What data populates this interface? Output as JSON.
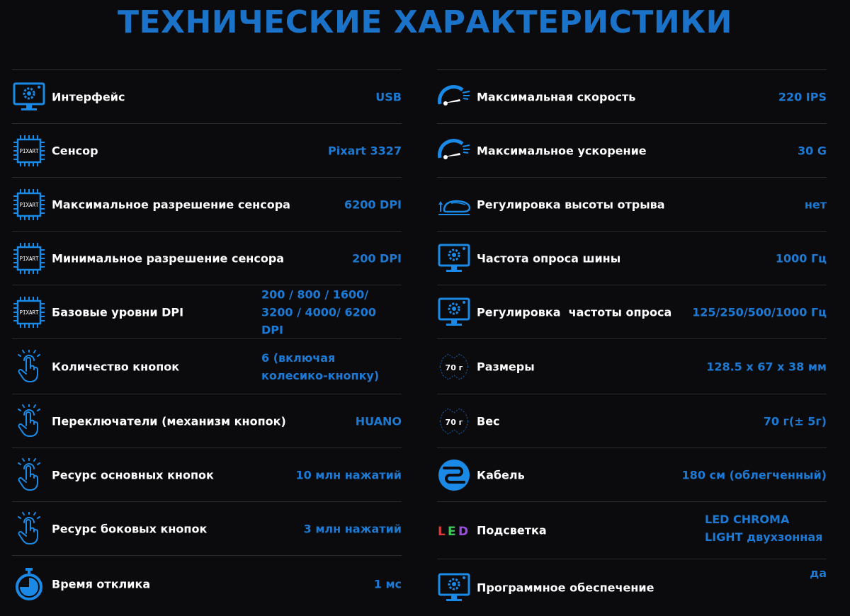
{
  "page_title": "ТЕХНИЧЕСКИЕ ХАРАКТЕРИСТИКИ",
  "colors": {
    "accent": "#1a73c9",
    "value": "#1d7ad4",
    "background": "#0b0b0d",
    "divider": "#2c2c30"
  },
  "chip_text": "PIXART",
  "weight_badge": "70 г",
  "led_letters": [
    "L",
    "E",
    "D"
  ],
  "left_specs": [
    {
      "icon": "monitor-gear-icon",
      "label": "Интерфейс",
      "value": "USB"
    },
    {
      "icon": "chip-icon",
      "label": "Сенсор",
      "value": "Pixart 3327"
    },
    {
      "icon": "chip-icon",
      "label": "Максимальное разрешение сенсора",
      "value": "6200 DPI"
    },
    {
      "icon": "chip-icon",
      "label": "Минимальное разрешение сенсора",
      "value": "200 DPI"
    },
    {
      "icon": "chip-icon",
      "label": "Базовые уровни DPI",
      "value": "200 / 800 / 1600/ 3200 / 4000/ 6200 DPI"
    },
    {
      "icon": "finger-tap-icon",
      "label": "Количество кнопок",
      "value": "6 (включая колесико-кнопку)"
    },
    {
      "icon": "finger-tap-icon",
      "label": "Переключатели (механизм кнопок)",
      "value": "HUANO"
    },
    {
      "icon": "finger-tap-icon",
      "label": "Ресурс основных кнопок",
      "value": "10 млн нажатий"
    },
    {
      "icon": "finger-tap-icon",
      "label": "Ресурс боковых кнопок",
      "value": "3 млн нажатий"
    },
    {
      "icon": "stopwatch-icon",
      "label": "Время отклика",
      "value": "1 мс"
    }
  ],
  "right_specs": [
    {
      "icon": "speedometer-icon",
      "label": "Максимальная скорость",
      "value": "220 IPS"
    },
    {
      "icon": "speedometer-icon",
      "label": "Максимальное ускорение",
      "value": "30 G"
    },
    {
      "icon": "mouse-lift-icon",
      "label": "Регулировка высоты отрыва",
      "value": "нет"
    },
    {
      "icon": "monitor-gear-icon",
      "label": "Частота опроса шины",
      "value": "1000 Гц"
    },
    {
      "icon": "monitor-gear-icon",
      "label": "Регулировка  частоты опроса",
      "value": "125/250/500/1000 Гц"
    },
    {
      "icon": "weight-badge-icon",
      "label": "Размеры",
      "value": "128.5 x 67 x 38 мм"
    },
    {
      "icon": "weight-badge-icon",
      "label": "Вес",
      "value": "70 г(± 5г)"
    },
    {
      "icon": "cable-icon",
      "label": "Кабель",
      "value": "180 см (облегченный)"
    },
    {
      "icon": "led-icon",
      "label": "Подсветка",
      "value": "LED CHROMA LIGHT двухзонная"
    },
    {
      "icon": "monitor-gear-icon",
      "label": "Программное обеспечение",
      "value": "да"
    }
  ]
}
